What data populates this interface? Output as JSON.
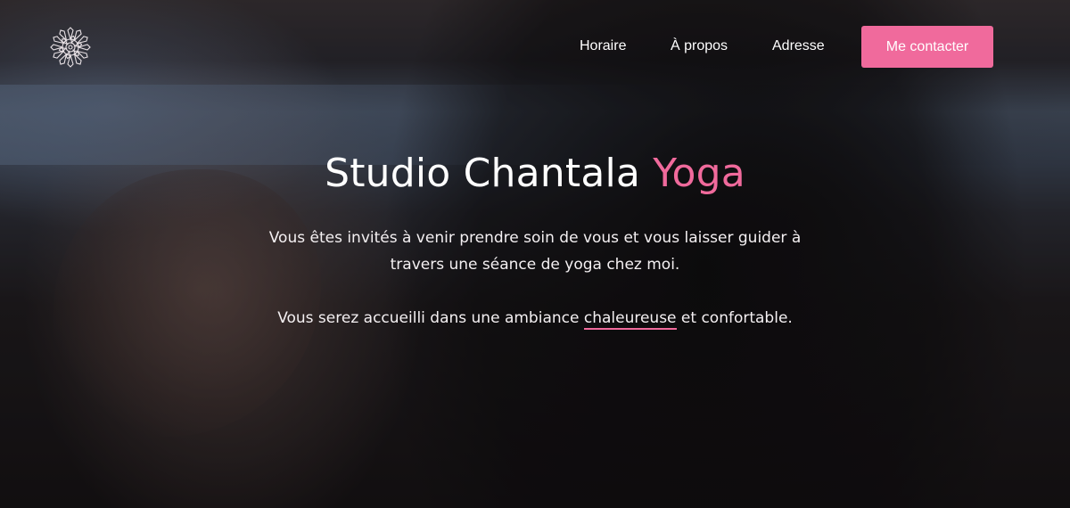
{
  "nav": {
    "logo_icon": "mandala-flower-icon",
    "links": [
      {
        "label": "Horaire"
      },
      {
        "label": "À propos"
      },
      {
        "label": "Adresse"
      }
    ],
    "cta_label": "Me contacter"
  },
  "hero": {
    "title_main": "Studio Chantala",
    "title_accent": "Yoga",
    "paragraph1": "Vous êtes invités à venir prendre soin de vous et vous laisser guider à travers une séance de yoga chez moi.",
    "paragraph2_before": "Vous serez accueilli dans une ambiance",
    "paragraph2_highlight": "chaleureuse",
    "paragraph2_after": "et confortable."
  },
  "colors": {
    "accent": "#f06a9c",
    "text": "#ffffff",
    "background": "#141012"
  }
}
